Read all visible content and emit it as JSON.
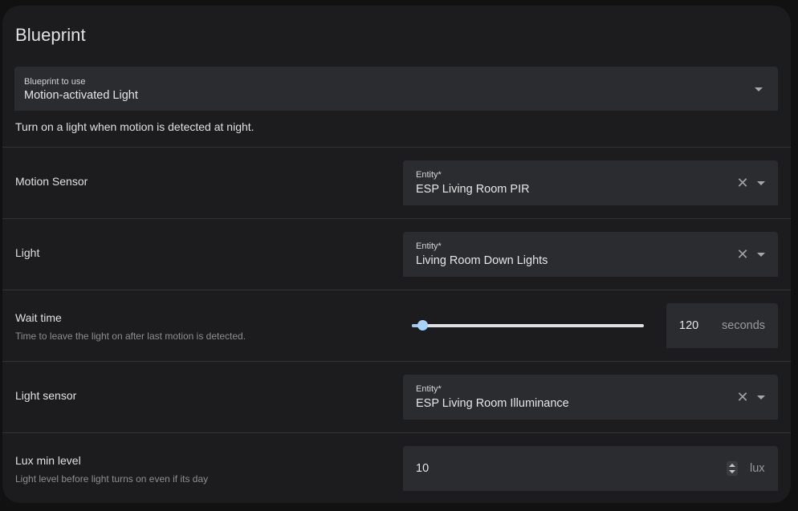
{
  "card": {
    "title": "Blueprint"
  },
  "blueprint_select": {
    "label": "Blueprint to use",
    "value": "Motion-activated Light",
    "icon": "chevron-down-icon"
  },
  "description": "Turn on a light when motion is detected at night.",
  "inputs": {
    "motion_sensor": {
      "label": "Motion Sensor",
      "field_label": "Entity*",
      "value": "ESP Living Room PIR"
    },
    "light": {
      "label": "Light",
      "field_label": "Entity*",
      "value": "Living Room Down Lights"
    },
    "wait_time": {
      "label": "Wait time",
      "description": "Time to leave the light on after last motion is detected.",
      "value": "120",
      "unit": "seconds",
      "slider_level": 0.03
    },
    "light_sensor": {
      "label": "Light sensor",
      "field_label": "Entity*",
      "value": "ESP Living Room Illuminance"
    },
    "lux_min_level": {
      "label": "Lux min level",
      "description": "Light level before light turns on even if its day",
      "value": "10",
      "unit": "lux"
    }
  },
  "icons": {
    "clear": "close-icon",
    "dropdown": "chevron-down-icon",
    "stepper": "unfold-icon"
  },
  "colors": {
    "accent": "#a8d1fb",
    "card": "#1c1c1e",
    "field": "#2b2c30"
  }
}
